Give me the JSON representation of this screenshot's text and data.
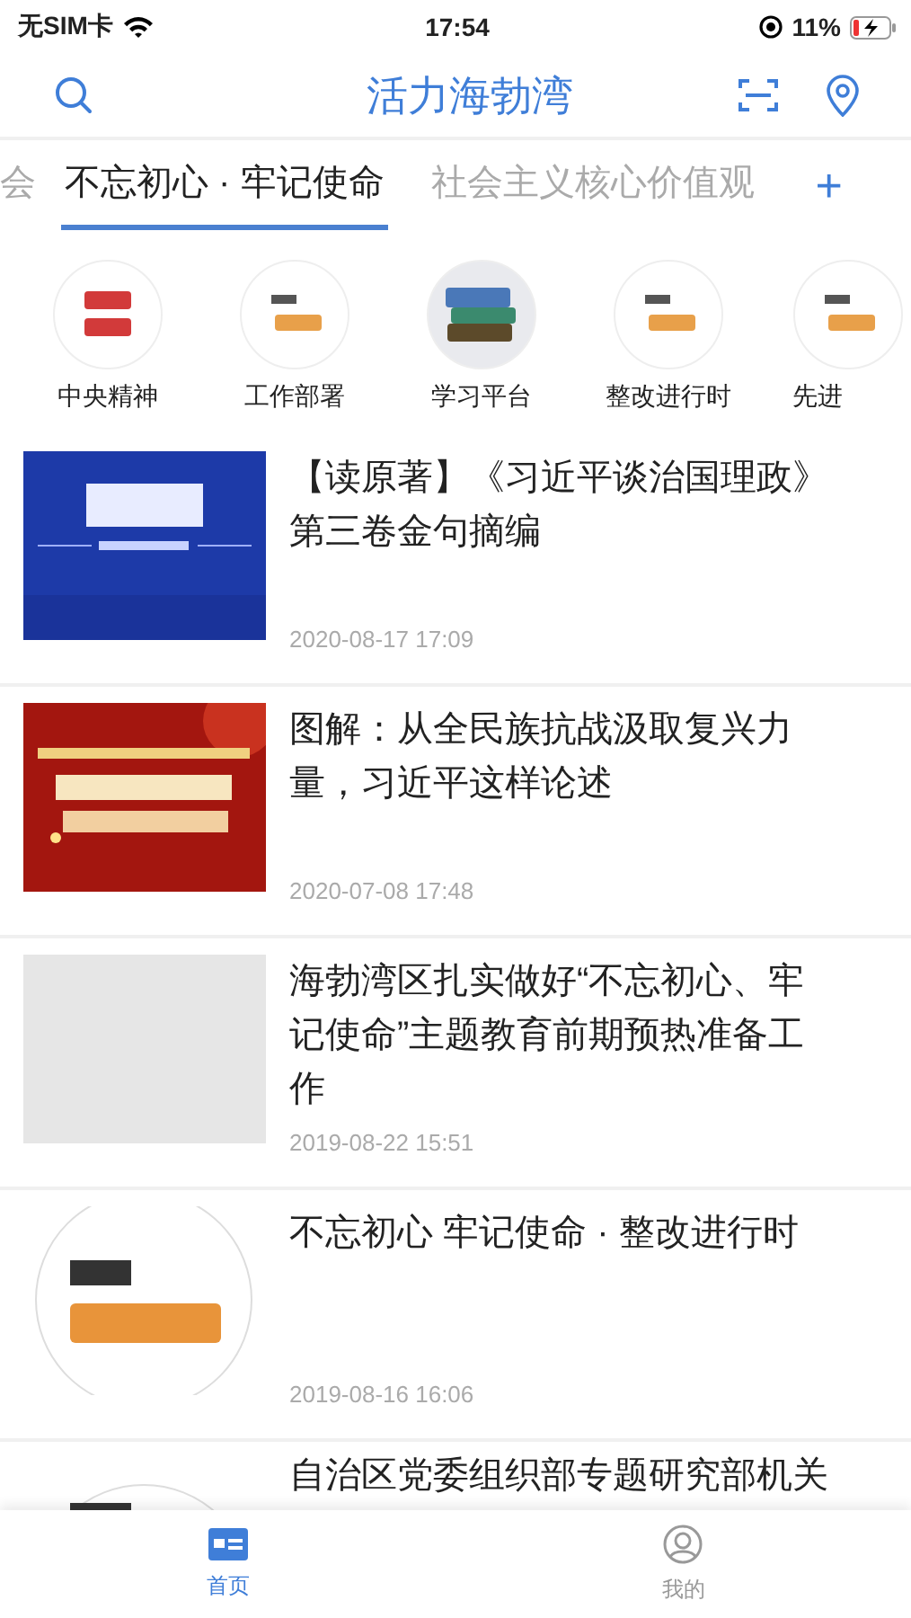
{
  "status_bar": {
    "carrier": "无SIM卡",
    "time": "17:54",
    "battery": "11%"
  },
  "header": {
    "title": "活力海勃湾"
  },
  "tabs": [
    {
      "label": "会",
      "selected": false
    },
    {
      "label": "不忘初心 · 牢记使命",
      "selected": true
    },
    {
      "label": "社会主义核心价值观",
      "selected": false
    }
  ],
  "add_tab": "+",
  "categories": [
    {
      "label": "中央精神"
    },
    {
      "label": "工作部署"
    },
    {
      "label": "学习平台"
    },
    {
      "label": "整改进行时"
    },
    {
      "label": "先进"
    }
  ],
  "articles": [
    {
      "title": "【读原著】《习近平谈治国理政》第三卷金句摘编",
      "date": "2020-08-17 17:09",
      "kind": "picture"
    },
    {
      "title": "图解：从全民族抗战汲取复兴力量，习近平这样论述",
      "date": "2020-07-08 17:48",
      "kind": "picture"
    },
    {
      "title": "海勃湾区扎实做好“不忘初心、牢记使命”主题教育前期预热准备工作",
      "date": "2019-08-22 15:51",
      "kind": "placeholder"
    },
    {
      "title": "不忘初心 牢记使命 · 整改进行时",
      "date": "2019-08-16 16:06",
      "kind": "picture"
    },
    {
      "title": "自治区党委组织部专题研究部机关",
      "kind": "picture"
    }
  ],
  "bottom_nav": [
    {
      "label": "首页",
      "selected": true
    },
    {
      "label": "我的",
      "selected": false
    }
  ]
}
